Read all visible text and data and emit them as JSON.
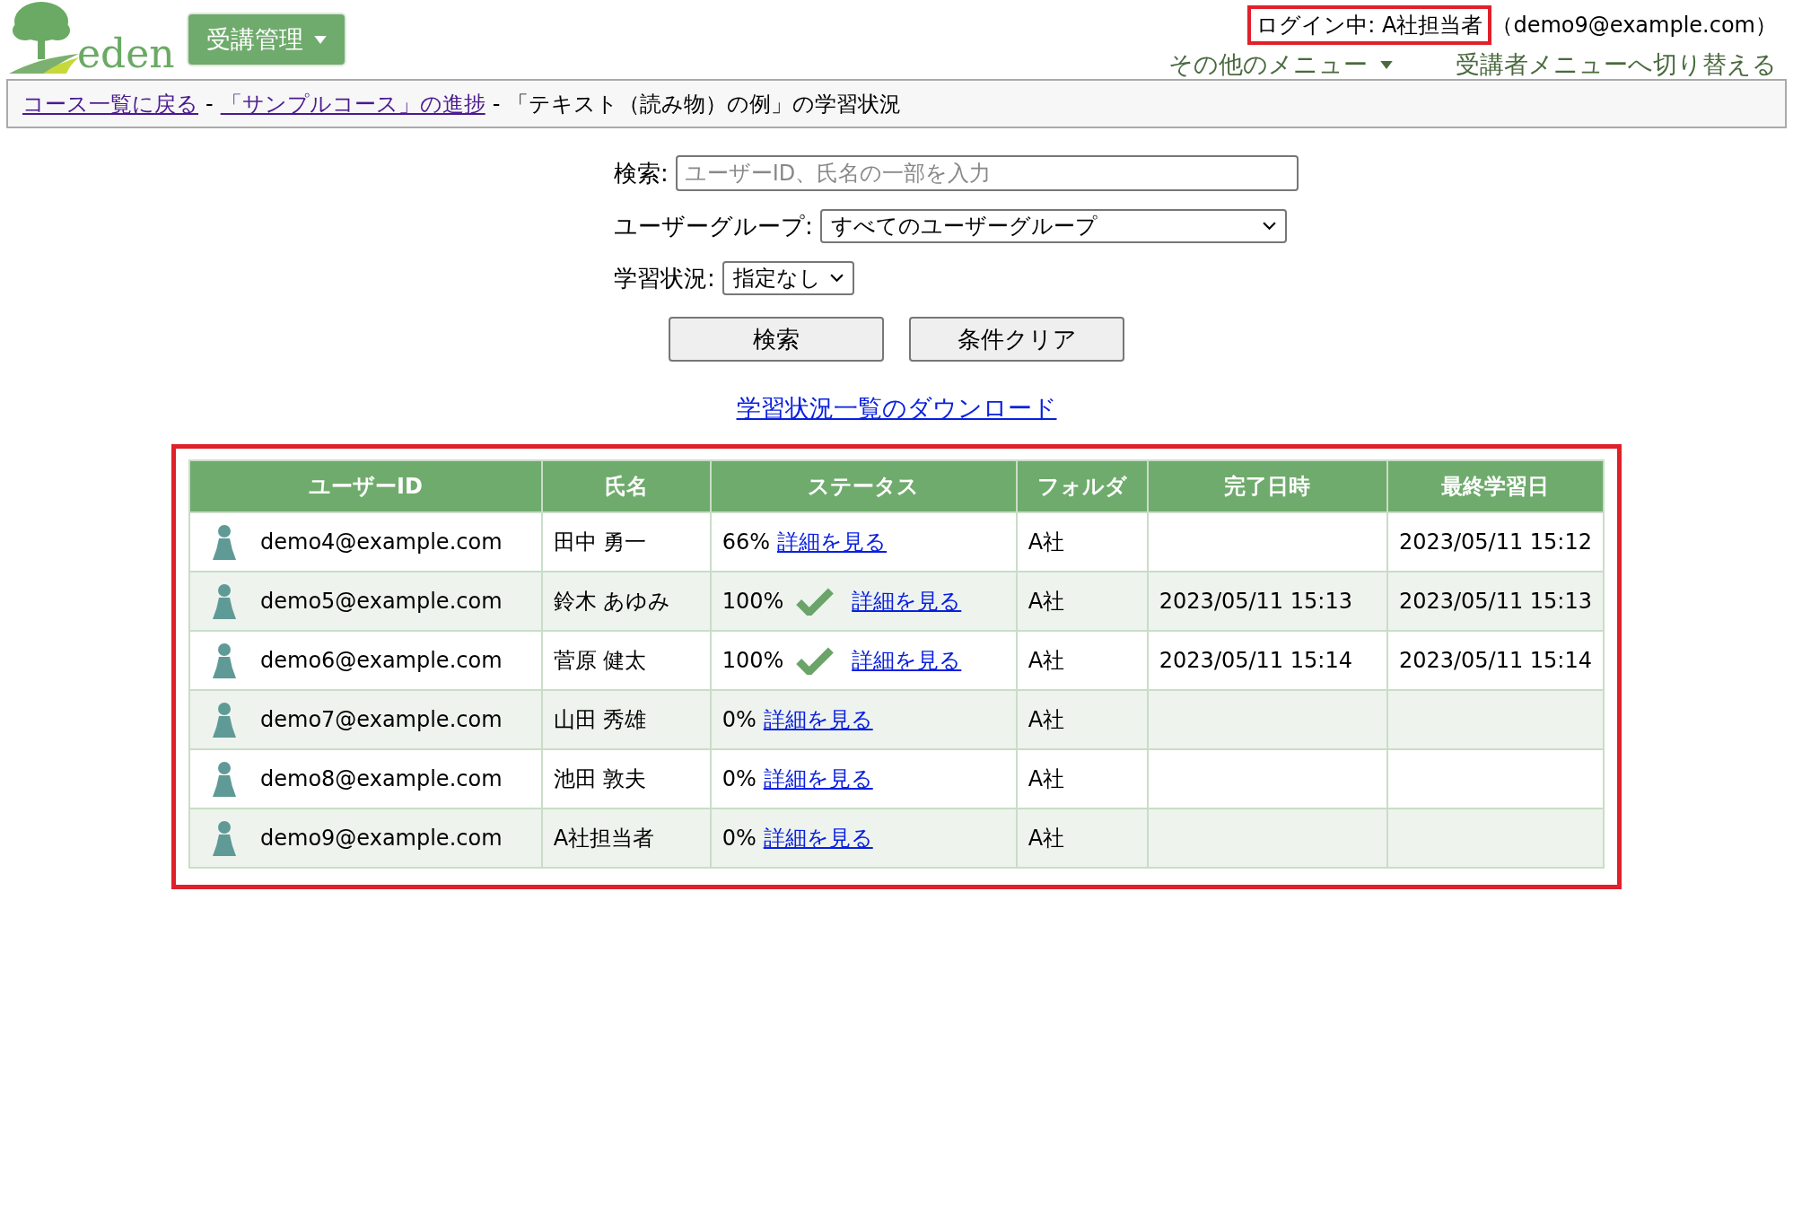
{
  "header": {
    "logo_text": "eden",
    "menu_button": "受講管理",
    "login": {
      "label": "ログイン中: A社担当者",
      "highlighted": true,
      "email": "（demo9@example.com）"
    },
    "links": [
      {
        "label": "その他のメニュー",
        "dropdown": true
      },
      {
        "label": "受講者メニューへ切り替える",
        "dropdown": false
      }
    ]
  },
  "breadcrumb": {
    "links": [
      "コース一覧に戻る",
      "「サンプルコース」の進捗"
    ],
    "separator": "-",
    "current": "「テキスト（読み物）の例」の学習状況"
  },
  "search": {
    "label": "検索:",
    "placeholder": "ユーザーID、氏名の一部を入力"
  },
  "filters": [
    {
      "label": "ユーザーグループ:",
      "value": "すべてのユーザーグループ",
      "wide": true
    },
    {
      "label": "学習状況:",
      "value": "指定なし",
      "wide": false
    }
  ],
  "buttons": [
    "検索",
    "条件クリア"
  ],
  "download_link": "学習状況一覧のダウンロード",
  "table": {
    "highlighted": true,
    "columns": [
      "ユーザーID",
      "氏名",
      "ステータス",
      "フォルダ",
      "完了日時",
      "最終学習日"
    ],
    "rows": [
      {
        "user_id": "demo4@example.com",
        "name": "田中 勇一",
        "progress": "66%",
        "completed": false,
        "detail": "詳細を見る",
        "folder": "A社",
        "completed_at": "",
        "last_study": "2023/05/11 15:12"
      },
      {
        "user_id": "demo5@example.com",
        "name": "鈴木 あゆみ",
        "progress": "100%",
        "completed": true,
        "detail": "詳細を見る",
        "folder": "A社",
        "completed_at": "2023/05/11 15:13",
        "last_study": "2023/05/11 15:13"
      },
      {
        "user_id": "demo6@example.com",
        "name": "菅原 健太",
        "progress": "100%",
        "completed": true,
        "detail": "詳細を見る",
        "folder": "A社",
        "completed_at": "2023/05/11 15:14",
        "last_study": "2023/05/11 15:14"
      },
      {
        "user_id": "demo7@example.com",
        "name": "山田 秀雄",
        "progress": "0%",
        "completed": false,
        "detail": "詳細を見る",
        "folder": "A社",
        "completed_at": "",
        "last_study": ""
      },
      {
        "user_id": "demo8@example.com",
        "name": "池田 敦夫",
        "progress": "0%",
        "completed": false,
        "detail": "詳細を見る",
        "folder": "A社",
        "completed_at": "",
        "last_study": ""
      },
      {
        "user_id": "demo9@example.com",
        "name": "A社担当者",
        "progress": "0%",
        "completed": false,
        "detail": "詳細を見る",
        "folder": "A社",
        "completed_at": "",
        "last_study": ""
      }
    ]
  }
}
